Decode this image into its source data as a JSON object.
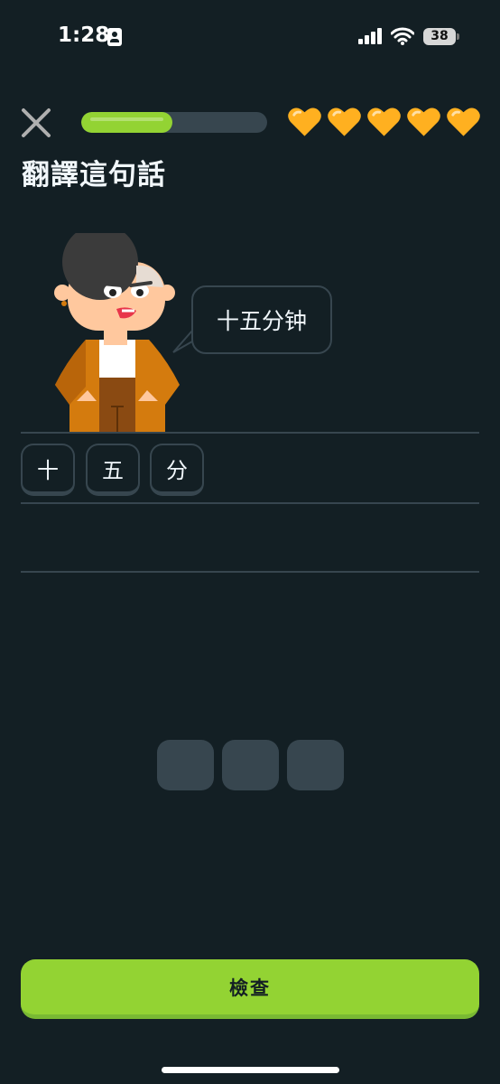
{
  "status_bar": {
    "time": "1:28",
    "battery": "38",
    "icons": [
      "id-card-icon",
      "signal-icon",
      "wifi-icon",
      "battery-icon"
    ]
  },
  "header": {
    "close_icon": "close-icon",
    "progress": 0.49,
    "hearts": 5,
    "colors": {
      "progress": "#93d333",
      "heart": "#ffb020"
    }
  },
  "title": "翻譯這句話",
  "prompt": {
    "sentence": "十五分钟",
    "character": "character-illustration"
  },
  "answer": {
    "selected_tiles": [
      "十",
      "五",
      "分"
    ]
  },
  "word_bank": {
    "empty_slots": 3
  },
  "check_button": {
    "label": "檢查",
    "color": "#93d333"
  },
  "theme": {
    "background": "#131f24",
    "border": "#37464f"
  }
}
